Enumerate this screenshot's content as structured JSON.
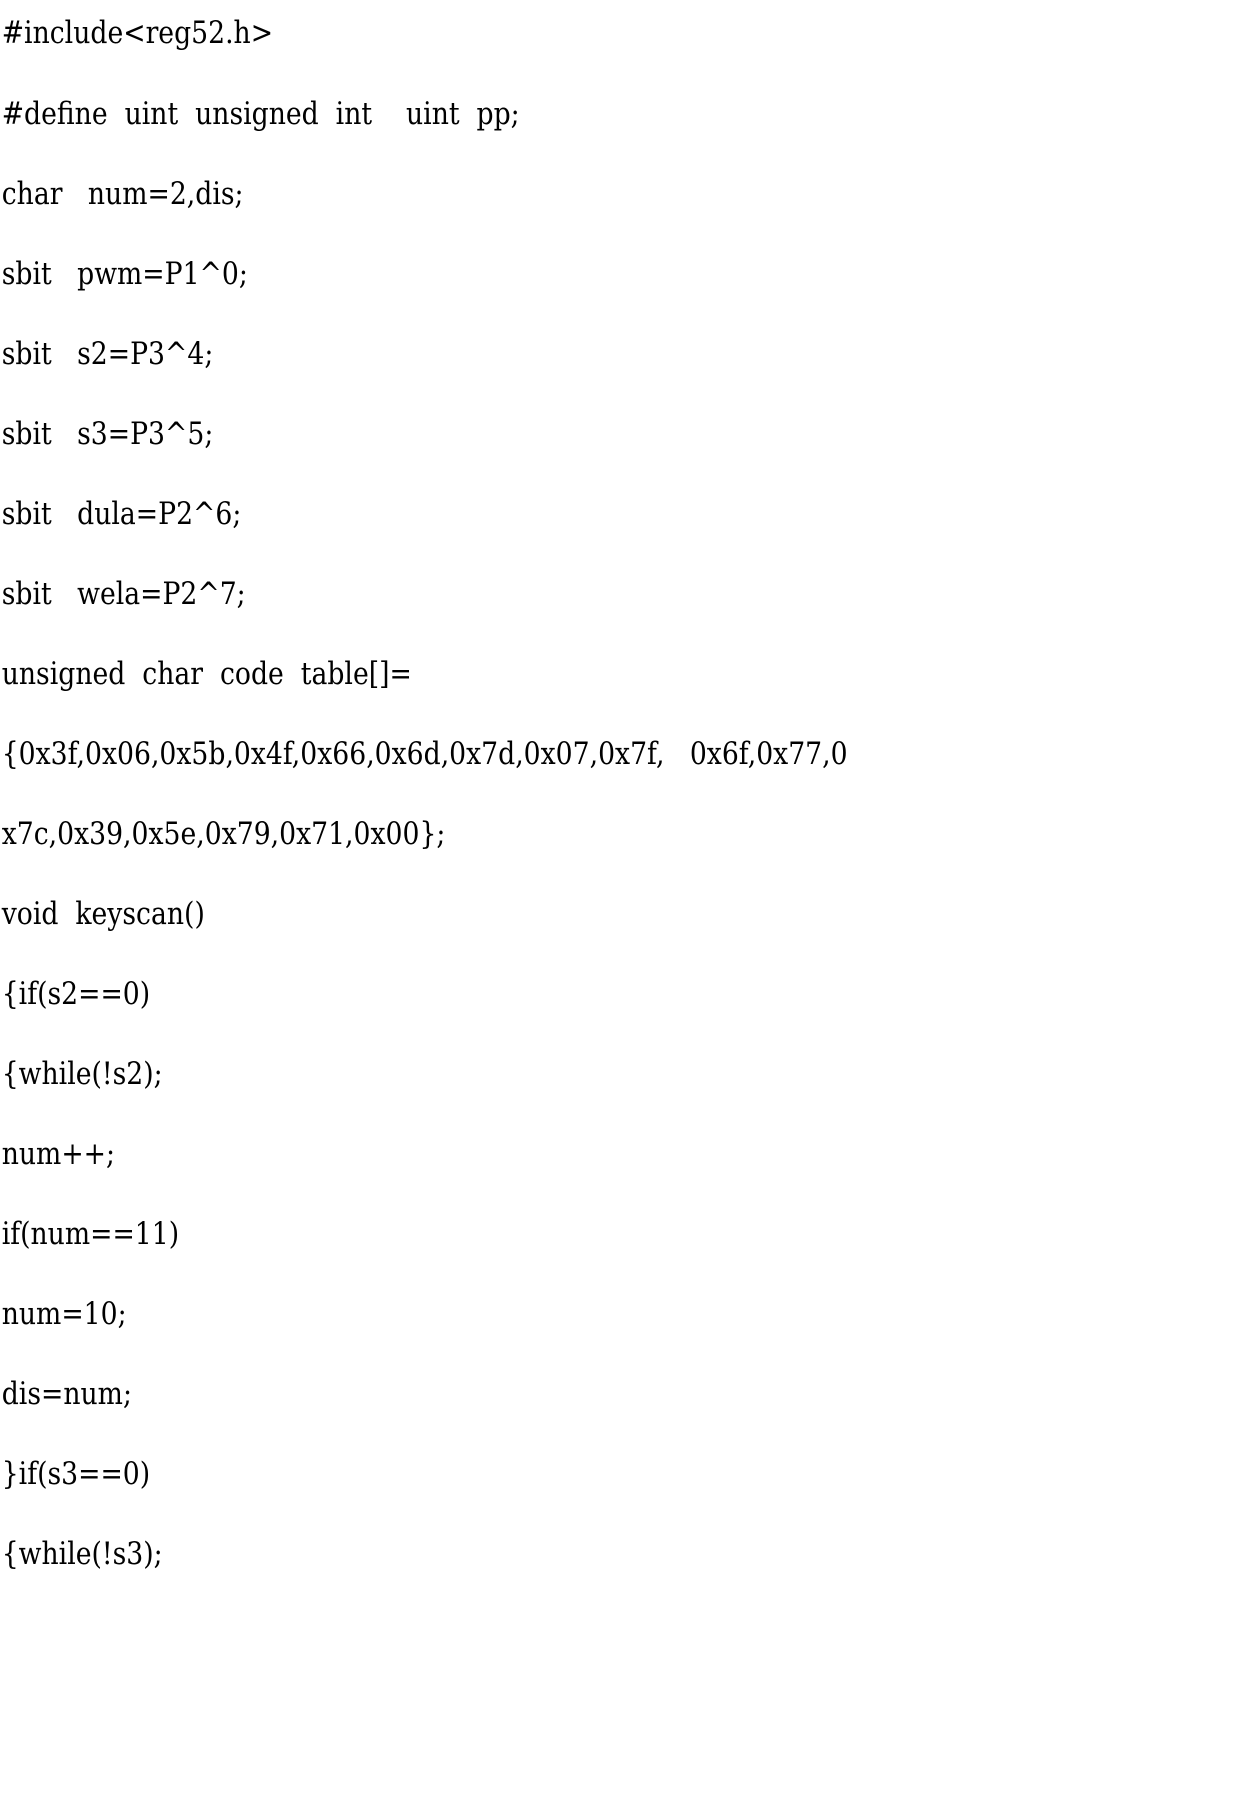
{
  "document": {
    "type": "scanned-source-code-page",
    "language": "C",
    "background_color": "#ffffff",
    "text_color": "#000000",
    "lines": [
      "#include<reg52.h>",
      "#define  uint  unsigned  int    uint  pp;",
      "char   num=2,dis;",
      "sbit   pwm=P1^0;",
      "sbit   s2=P3^4;",
      "sbit   s3=P3^5;",
      "sbit   dula=P2^6;",
      "sbit   wela=P2^7;",
      "unsigned  char  code  table[]=",
      "{0x3f,0x06,0x5b,0x4f,0x66,0x6d,0x7d,0x07,0x7f,   0x6f,0x77,0",
      "x7c,0x39,0x5e,0x79,0x71,0x00};",
      "void  keyscan()",
      "{if(s2==0)",
      "{while(!s2);",
      "num++;",
      "if(num==11)",
      "num=10;",
      "dis=num;",
      "}if(s3==0)",
      "{while(!s3);"
    ]
  }
}
